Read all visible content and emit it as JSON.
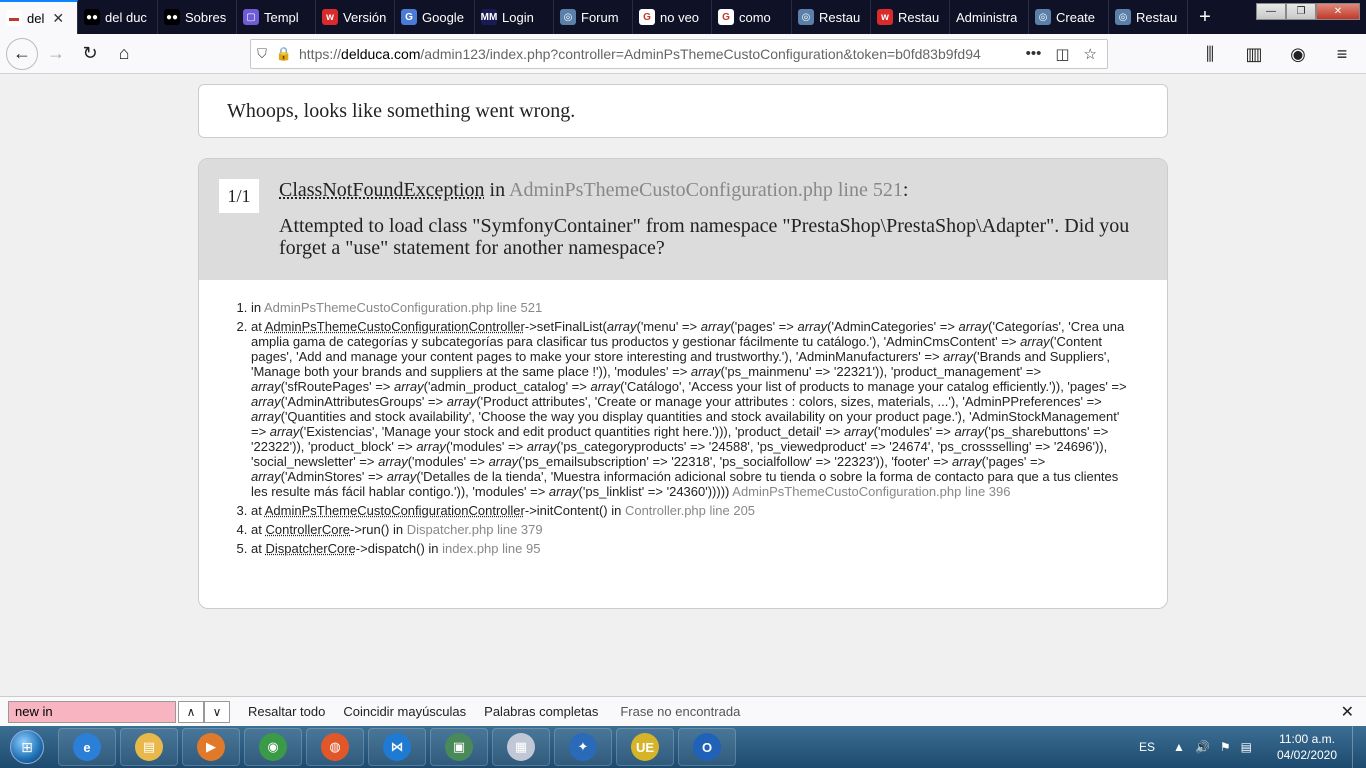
{
  "browser": {
    "tabs": [
      {
        "label": "del",
        "icon_color": "#ffffff",
        "icon_text": "▬",
        "active": true
      },
      {
        "label": "del duc",
        "icon_color": "#000000",
        "icon_text": "●●"
      },
      {
        "label": "Sobres",
        "icon_color": "#000000",
        "icon_text": "●●"
      },
      {
        "label": "Templ",
        "icon_color": "#6f5bd6",
        "icon_text": "▢"
      },
      {
        "label": "Versión",
        "icon_color": "#d92b2b",
        "icon_text": "w"
      },
      {
        "label": "Google",
        "icon_color": "#4a7bd6",
        "icon_text": "G"
      },
      {
        "label": "Login",
        "icon_color": "#1a1a55",
        "icon_text": "MM"
      },
      {
        "label": "Forum",
        "icon_color": "#5a7fa8",
        "icon_text": "◎"
      },
      {
        "label": "no veo",
        "icon_color": "#ffffff",
        "icon_text": "G"
      },
      {
        "label": "como",
        "icon_color": "#ffffff",
        "icon_text": "G"
      },
      {
        "label": "Restau",
        "icon_color": "#5a7fa8",
        "icon_text": "◎"
      },
      {
        "label": "Restau",
        "icon_color": "#d92b2b",
        "icon_text": "w"
      },
      {
        "label": "Administra",
        "icon_color": "",
        "icon_text": ""
      },
      {
        "label": "Create",
        "icon_color": "#5a7fa8",
        "icon_text": "◎"
      },
      {
        "label": "Restau",
        "icon_color": "#5a7fa8",
        "icon_text": "◎"
      }
    ],
    "new_tab": "+",
    "url_prefix": "https://",
    "url_domain": "delduca.com",
    "url_path": "/admin123/index.php?controller=AdminPsThemeCustoConfiguration&token=b0fd83b9fd94",
    "url_more": "•••"
  },
  "page": {
    "whoops": "Whoops, looks like something went wrong.",
    "counter": "1/1",
    "exception_class": "ClassNotFoundException",
    "exception_in": " in ",
    "exception_file": "AdminPsThemeCustoConfiguration.php line 521",
    "exception_colon": ":",
    "exception_message": "Attempted to load class \"SymfonyContainer\" from namespace \"PrestaShop\\PrestaShop\\Adapter\". Did you forget a \"use\" statement for another namespace?",
    "trace": {
      "t1_in": "in ",
      "t1_file": "AdminPsThemeCustoConfiguration.php line 521",
      "t2_at": "at ",
      "t2_class": "AdminPsThemeCustoConfigurationController",
      "t2_call": "->setFinalList(",
      "t2_args": "array('menu' => array('pages' => array('AdminCategories' => array('Categorías', 'Crea una amplia gama de categorías y subcategorías para clasificar tus productos y gestionar fácilmente tu catálogo.'), 'AdminCmsContent' => array('Content pages', 'Add and manage your content pages to make your store interesting and trustworthy.'), 'AdminManufacturers' => array('Brands and Suppliers', 'Manage both your brands and suppliers at the same place !')), 'modules' => array('ps_mainmenu' => '22321')), 'product_management' => array('sfRoutePages' => array('admin_product_catalog' => array('Catálogo', 'Access your list of products to manage your catalog efficiently.')), 'pages' => array('AdminAttributesGroups' => array('Product attributes', 'Create or manage your attributes : colors, sizes, materials, ...'), 'AdminPPreferences' => array('Quantities and stock availability', 'Choose the way you display quantities and stock availability on your product page.'), 'AdminStockManagement' => array('Existencias', 'Manage your stock and edit product quantities right here.'))), 'product_detail' => array('modules' => array('ps_sharebuttons' => '22322')), 'product_block' => array('modules' => array('ps_categoryproducts' => '24588', 'ps_viewedproduct' => '24674', 'ps_crossselling' => '24696')), 'social_newsletter' => array('modules' => array('ps_emailsubscription' => '22318', 'ps_socialfollow' => '22323')), 'footer' => array('pages' => array('AdminStores' => array('Detalles de la tienda', 'Muestra información adicional sobre tu tienda o sobre la forma de contacto para que a tus clientes les resulte más fácil hablar contigo.')), 'modules' => array('ps_linklist' => '24360'))))",
      "t2_close": ") ",
      "t2_file": "AdminPsThemeCustoConfiguration.php line 396",
      "t3_at": "at ",
      "t3_class": "AdminPsThemeCustoConfigurationController",
      "t3_call": "->initContent() in ",
      "t3_file": "Controller.php line 205",
      "t4_at": "at ",
      "t4_class": "ControllerCore",
      "t4_call": "->run() in ",
      "t4_file": "Dispatcher.php line 379",
      "t5_at": "at ",
      "t5_class": "DispatcherCore",
      "t5_call": "->dispatch() in ",
      "t5_file": "index.php line 95"
    }
  },
  "findbar": {
    "query": "new in",
    "highlight_all": "Resaltar todo",
    "match_case": "Coincidir mayúsculas",
    "whole_words": "Palabras completas",
    "status": "Frase no encontrada"
  },
  "taskbar": {
    "apps": [
      {
        "name": "ie",
        "color": "#2b7fd6",
        "glyph": "e"
      },
      {
        "name": "explorer",
        "color": "#e8b94a",
        "glyph": "▤"
      },
      {
        "name": "media",
        "color": "#e07a2a",
        "glyph": "▶"
      },
      {
        "name": "chrome",
        "color": "#3a9a48",
        "glyph": "◉"
      },
      {
        "name": "firefox",
        "color": "#e2572a",
        "glyph": "◍"
      },
      {
        "name": "vscode",
        "color": "#1f7ad1",
        "glyph": "⋈"
      },
      {
        "name": "screen",
        "color": "#4a8a5a",
        "glyph": "▣"
      },
      {
        "name": "calculator",
        "color": "#bfc8d4",
        "glyph": "▦"
      },
      {
        "name": "network",
        "color": "#2a6ab8",
        "glyph": "✦"
      },
      {
        "name": "ultraedit",
        "color": "#d6b42a",
        "glyph": "UE"
      },
      {
        "name": "outlook",
        "color": "#1f62b8",
        "glyph": "O"
      }
    ],
    "lang": "ES",
    "time": "11:00 a.m.",
    "date": "04/02/2020"
  }
}
